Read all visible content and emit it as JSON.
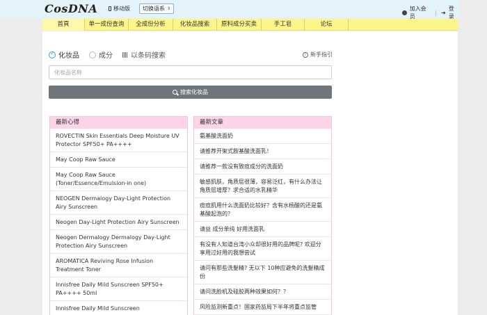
{
  "header": {
    "logo_text": "CosDNA",
    "mobile_label": "移动版",
    "language_label": "切换语系",
    "join_label": "加入会员",
    "login_label": "登录"
  },
  "nav": {
    "items": [
      {
        "label": "首頁"
      },
      {
        "label": "单一成份查询"
      },
      {
        "label": "全成份分析"
      },
      {
        "label": "化妆品搜索"
      },
      {
        "label": "原料成分买卖"
      },
      {
        "label": "手工皂"
      },
      {
        "label": "论坛"
      }
    ]
  },
  "search": {
    "option_cosmetics": "化妆品",
    "option_ingredient": "成分",
    "option_barcode": "以条码搜索",
    "guide_label": "新手指引",
    "placeholder": "化妆品名称",
    "button_label": "搜索化妆品",
    "selected_option": "化妆品"
  },
  "latest_reviews": {
    "title": "最新心得",
    "items": [
      "ROVECTIN Skin Essentials Deep Moisture UV Protector SPF50+ PA++++",
      "May Coop Raw Sauce",
      "May Coop Raw Sauce (Toner/Essence/Emulsion-in one)",
      "NEOGEN Dermalogy Day-Light Protection Airy Sunscreen",
      "Neogen Day-Light Protection Airy Sunscreen",
      "Neogen Dermalogy Dermalogy Day-Light Protection Airy Sunscreen",
      "AROMATICA Reviving Rose Infusion Treatment Toner",
      "Innisfree Daily Mild Sunscreen SPF50+ PA++++ 50ml",
      "Innisfree Daily Mild Sunscreen"
    ]
  },
  "latest_articles": {
    "title": "最新文章",
    "items": [
      "氨基酸洗面奶",
      "请推荐开架式胺基酸洗面乳！",
      "请推荐一款没有致痘成分的洗面奶",
      "敏感肌肤，角质层很薄，容易泛红，有什么办法让角质层增厚？求合适的水乳精华",
      "痘痘肌用什么洗面奶比较好？含有水杨酸的还是氨基酸起泡的？",
      "请益 成分单纯 好用洗面乳",
      "有没有人知道台湾小众却很好用的品牌呢? 欢迎分享用过好用的我想尝试",
      "请问有那些洗髮精? 无以下 10种应避免的洗髮精成份",
      "请问洗脸机及硅胶两种效果如何？？",
      "风险监测新重点！国家药监局下半年将重点监管"
    ]
  }
}
